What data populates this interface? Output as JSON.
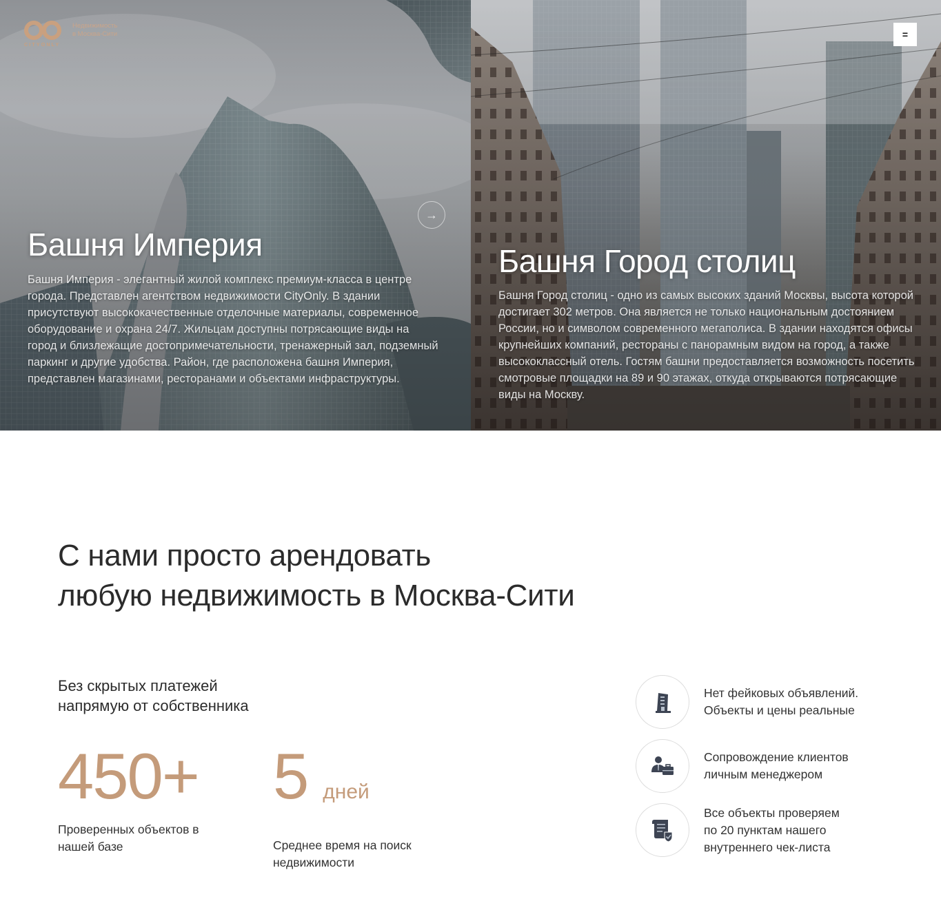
{
  "brand": {
    "name": "CITYONLY",
    "tagline_line1": "Недвижимость",
    "tagline_line2": "в Москва-Сити",
    "accent_color": "#c49b7a"
  },
  "header": {
    "menu_icon": "hamburger-menu-icon",
    "menu_glyph": "="
  },
  "slides": [
    {
      "title": "Башня Империя",
      "text": "Башня Империя - элегантный жилой комплекс премиум-класса в центре города. Представлен агентством недвижимости CityOnly. В здании присутствуют высококачественные отделочные материалы, современное оборудование и охрана 24/7. Жильцам доступны потрясающие виды на город и близлежащие достопримечательности, тренажерный зал, подземный паркинг и другие удобства. Район, где расположена башня Империя, представлен магазинами, ресторанами и объектами инфраструктуры."
    },
    {
      "title": "Башня Город столиц",
      "text": "Башня Город столиц - одно из самых высоких зданий Москвы, высота которой достигает 302 метров. Она является не только национальным достоянием России, но и символом современного мегаполиса. В здании находятся офисы крупнейших компаний, рестораны с панорамным видом на город, а также высококлассный отель. Гостям башни предоставляется возможность посетить смотровые площадки на 89 и 90 этажах, откуда открываются потрясающие виды на Москву."
    }
  ],
  "slider": {
    "next_icon": "arrow-right-icon",
    "next_glyph": "→"
  },
  "main": {
    "headline_line1": "С нами просто арендовать",
    "headline_line2": "любую недвижимость в Москва-Сити",
    "subhead_line1": "Без скрытых платежей",
    "subhead_line2": "напрямую от собственника",
    "stats": [
      {
        "value": "450+",
        "unit": "",
        "label_line1": "Проверенных объектов в",
        "label_line2": "нашей базе"
      },
      {
        "value": "5",
        "unit": "дней",
        "label_line1": "Среднее время на поиск",
        "label_line2": "недвижимости"
      }
    ],
    "features": [
      {
        "icon": "building-icon",
        "line1": "Нет фейковых объявлений.",
        "line2": "Объекты и цены реальные",
        "line3": ""
      },
      {
        "icon": "manager-briefcase-icon",
        "line1": "Сопровождение клиентов",
        "line2": "личным менеджером",
        "line3": ""
      },
      {
        "icon": "checklist-scroll-icon",
        "line1": "Все объекты проверяем",
        "line2": "по 20 пунктам нашего",
        "line3": "внутреннего чек-листа"
      }
    ]
  }
}
